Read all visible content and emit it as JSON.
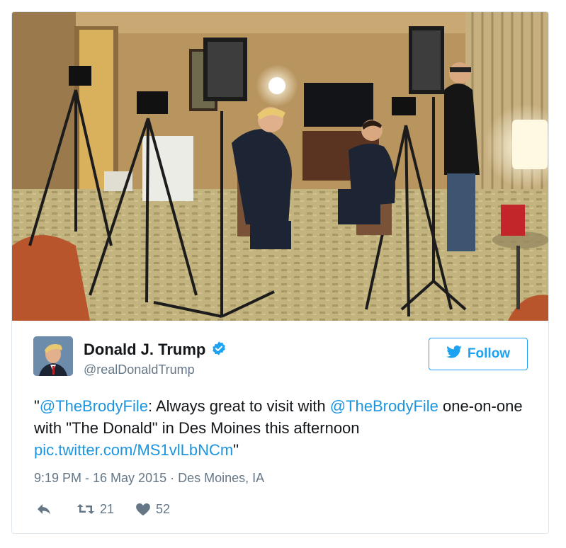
{
  "tweet": {
    "author_name": "Donald J. Trump",
    "handle": "@realDonaldTrump",
    "follow_label": "Follow",
    "text_open_quote": "\"",
    "mention_1": "@TheBrodyFile",
    "text_part_1": ": Always great to visit with ",
    "mention_2": "@TheBrodyFile",
    "text_part_2": " one-on-one with \"The Donald\" in Des Moines this afternoon ",
    "link": "pic.twitter.com/MS1vlLbNCm",
    "text_close_quote": "\"",
    "timestamp": "9:19 PM - 16 May 2015",
    "separator": " · ",
    "location": "Des Moines, IA",
    "retweet_count": "21",
    "like_count": "52"
  },
  "icons": {
    "verified": "verified-badge-icon",
    "bird": "twitter-bird-icon",
    "reply": "reply-icon",
    "retweet": "retweet-icon",
    "like": "heart-icon"
  },
  "colors": {
    "accent": "#1da1f2",
    "link": "#1b95e0",
    "muted": "#657786",
    "border": "#e1e8ed"
  }
}
